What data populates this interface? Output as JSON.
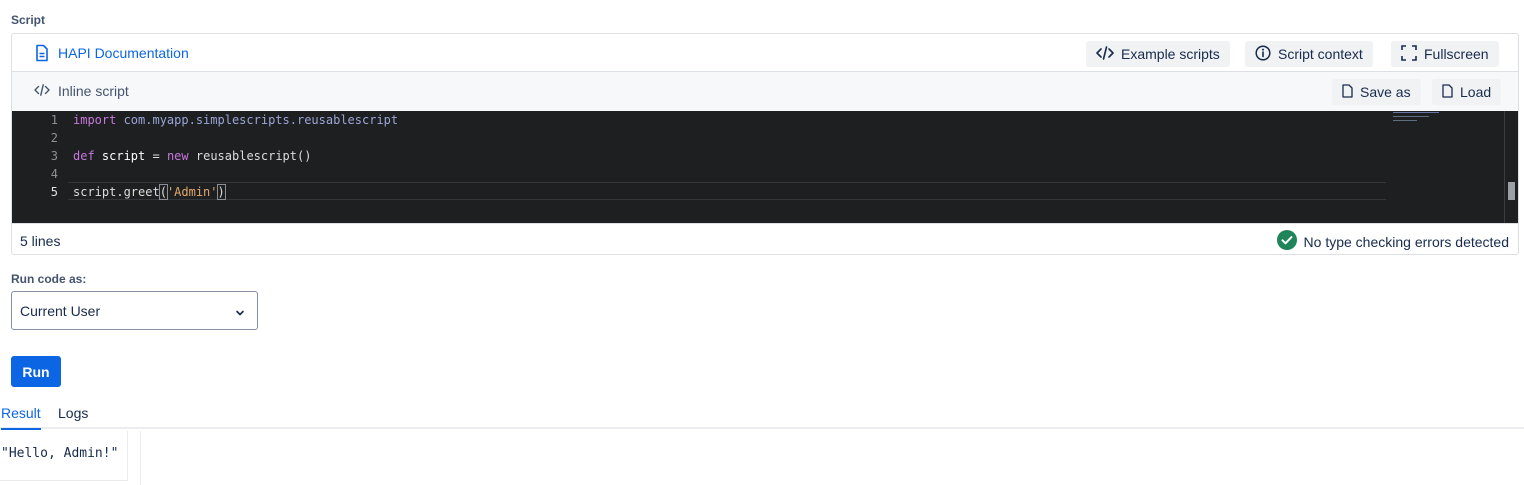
{
  "section_label": "Script",
  "toolbar": {
    "doc_link": "HAPI Documentation",
    "example_scripts": "Example scripts",
    "script_context": "Script context",
    "fullscreen": "Fullscreen"
  },
  "subtoolbar": {
    "inline_script": "Inline script",
    "save_as": "Save as",
    "load": "Load"
  },
  "editor": {
    "line_numbers": [
      "1",
      "2",
      "3",
      "4",
      "5"
    ],
    "lines": {
      "l1_kw": "import",
      "l1_pkg": " com.myapp.simplescripts.reusablescript",
      "l3_kw": "def",
      "l3_id": " script",
      "l3_eq": " = ",
      "l3_new": "new",
      "l3_rest": " reusablescript()",
      "l5_a": "script.greet",
      "l5_open": "(",
      "l5_str": "'Admin'",
      "l5_close": ")"
    }
  },
  "status": {
    "line_count": "5 lines",
    "type_check": "No type checking errors detected"
  },
  "run_as": {
    "label": "Run code as:",
    "selected": "Current User"
  },
  "run_button": "Run",
  "tabs": [
    {
      "label": "Result",
      "active": true
    },
    {
      "label": "Logs",
      "active": false
    }
  ],
  "result_output": "\"Hello, Admin!\"",
  "colors": {
    "accent": "#0c66e4",
    "success": "#1f845a",
    "editor_bg": "#1e1f21"
  }
}
